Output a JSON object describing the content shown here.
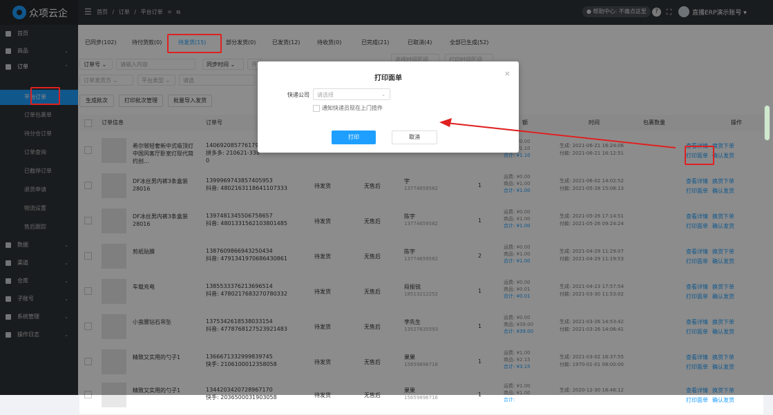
{
  "header": {
    "logo_text": "众项云企",
    "menu_icon": "hamburger-icon",
    "breadcrumb": [
      "首页",
      "/",
      "订单",
      "/",
      "平台订单",
      "≐",
      "⧉"
    ],
    "help_text": "● 帮助中心: 不痛点这里",
    "username": "直播ERP演示账号 ▾"
  },
  "sidebar": {
    "items": [
      {
        "label": "首页",
        "arrow": ""
      },
      {
        "label": "商品",
        "arrow": "⌄"
      },
      {
        "label": "订单",
        "arrow": "⌃"
      }
    ],
    "sub_items": [
      "平台订单",
      "订单包裹单",
      "待分仓订单",
      "订单查询",
      "已截停订单",
      "退货申请",
      "物流设置",
      "售后跟踪"
    ],
    "more_items": [
      {
        "label": "数据",
        "arrow": "⌄"
      },
      {
        "label": "渠道",
        "arrow": "⌄"
      },
      {
        "label": "仓库",
        "arrow": "⌄"
      },
      {
        "label": "子账号",
        "arrow": "⌄"
      },
      {
        "label": "系统管理",
        "arrow": "⌄"
      },
      {
        "label": "操作日志",
        "arrow": "⌄"
      }
    ]
  },
  "tabs": [
    "已同步(102)",
    "待付货款(0)",
    "待发货(15)",
    "部分发货(0)",
    "已发货(12)",
    "待收货(0)",
    "已完成(21)",
    "已取消(4)",
    "全部已生成(52)"
  ],
  "filters": {
    "row1": [
      "订单号 ⌄",
      "请输入内容",
      "同步时间 ⌄",
      "开",
      "至",
      "结束时间",
      "选择时间区间",
      "打印时间区间"
    ],
    "row2": [
      "订单发货方 ⌄",
      "平台类型 ⌄",
      "请选"
    ]
  },
  "actions": [
    "生成批次",
    "打印批次管理",
    "批量导入发货"
  ],
  "table_headers": [
    "订单信息",
    "订单号",
    "额",
    "时间",
    "包裹数量",
    "操作"
  ],
  "rows": [
    {
      "name": "希尔顿轻奢新中式吸顶灯中国风客厅卧室灯现代简约创...",
      "order_no": "14069208577617920",
      "platform_no": "拼多多: 210621-338",
      "extra": "0",
      "status": "",
      "after": "",
      "buyer": "",
      "phone": "13774659582",
      "qty": "",
      "fee": "运费: ¥0.00",
      "goods": "商品: ¥1.10",
      "total": "合计: ¥1.10",
      "created": "生成: 2021-06-21 16:24:06",
      "paid": "付款: 2021-06-21 16:12:51",
      "op1": "查看详情",
      "op2": "换货下单",
      "op3": "打印面单",
      "op4": "确认发货"
    },
    {
      "name": "DF冰丝男内裤3条盒装28016",
      "order_no": "1399969743857405953",
      "platform_no": "抖音: 4802163118641107333",
      "extra": "",
      "status": "待发货",
      "after": "无售后",
      "buyer": "宇",
      "phone": "13774659582",
      "qty": "1",
      "fee": "运费: ¥0.00",
      "goods": "商品: ¥1.00",
      "total": "合计: ¥1.00",
      "created": "生成: 2021-06-02 14:02:52",
      "paid": "付款: 2021-05-28 15:08:13",
      "op1": "查看详情",
      "op2": "换货下单",
      "op3": "打印面单",
      "op4": "确认发货"
    },
    {
      "name": "DF冰丝男内裤3条盒装28016",
      "order_no": "1397481345506758657",
      "platform_no": "抖音: 4801331562103801485",
      "extra": "",
      "status": "待发货",
      "after": "无售后",
      "buyer": "陈宇",
      "phone": "13774659582",
      "qty": "1",
      "fee": "运费: ¥0.00",
      "goods": "商品: ¥1.00",
      "total": "合计: ¥1.00",
      "created": "生成: 2021-05-26 17:14:51",
      "paid": "付款: 2021-05-26 09:24:24",
      "op1": "查看详情",
      "op2": "换货下单",
      "op3": "打印面单",
      "op4": "确认发货"
    },
    {
      "name": "剪纸贴膜",
      "order_no": "138760986694325043­4",
      "platform_no": "抖音: 4791341970686430861",
      "extra": "",
      "status": "待发货",
      "after": "无售后",
      "buyer": "陈宇",
      "phone": "13774659582",
      "qty": "2",
      "fee": "运费: ¥0.00",
      "goods": "商品: ¥1.00",
      "total": "合计: ¥1.00",
      "created": "生成: 2021-04-29 11:29:07",
      "paid": "付款: 2021-04-29 11:19:53",
      "op1": "查看详情",
      "op2": "换货下单",
      "op3": "打印面单",
      "op4": "确认发货"
    },
    {
      "name": "车载充电",
      "order_no": "1385533376213696514",
      "platform_no": "抖音: 4780217683270780332",
      "extra": "",
      "status": "待发货",
      "after": "无售后",
      "buyer": "段振锐",
      "phone": "18513212252",
      "qty": "1",
      "fee": "运费: ¥0.00",
      "goods": "商品: ¥0.01",
      "total": "合计: ¥0.01",
      "created": "生成: 2021-04-23 17:57:54",
      "paid": "付款: 2021-03-30 11:53:02",
      "op1": "查看详情",
      "op2": "换货下单",
      "op3": "打印面单",
      "op4": "确认发货"
    },
    {
      "name": "小蛮腰钻石吊坠",
      "order_no": "1375342618538033154",
      "platform_no": "抖音: 4778768127523921483",
      "extra": "",
      "status": "待发货",
      "after": "无售后",
      "buyer": "李先生",
      "phone": "13527635593",
      "qty": "1",
      "fee": "运费: ¥0.00",
      "goods": "商品: ¥39.00",
      "total": "合计: ¥39.00",
      "created": "生成: 2021-03-26 14:53:42",
      "paid": "付款: 2021-03-26 14:06:41",
      "op1": "查看详情",
      "op2": "换货下单",
      "op3": "打印面单",
      "op4": "确认发货"
    },
    {
      "name": "精致又实用的勺子1",
      "order_no": "1366671332999839745",
      "platform_no": "快手: 2106100012358058",
      "extra": "",
      "status": "待发货",
      "after": "无售后",
      "buyer": "果果",
      "phone": "15659896716",
      "qty": "1",
      "fee": "运费: ¥1.00",
      "goods": "商品: ¥2.15",
      "total": "合计: ¥3.15",
      "created": "生成: 2021-03-02 16:37:55",
      "paid": "付款: 1970-01-01 08:00:00",
      "op1": "查看详情",
      "op2": "换货下单",
      "op3": "打印面单",
      "op4": "确认发货"
    },
    {
      "name": "精致又实用的勺子1",
      "order_no": "1344203420728967170",
      "platform_no": "快手: 2036500031903058",
      "extra": "",
      "status": "待发货",
      "after": "无售后",
      "buyer": "果果",
      "phone": "15659896716",
      "qty": "1",
      "fee": "运费: ¥1.00",
      "goods": "商品: ¥1.00",
      "total": "合计:",
      "created": "生成: 2020-12-30 16:46:12",
      "paid": "",
      "op1": "查看详情",
      "op2": "换货下单",
      "op3": "打印面单",
      "op4": "确认发货"
    }
  ],
  "modal": {
    "title": "打印面单",
    "close": "×",
    "field_label": "快递公司",
    "select_placeholder": "请选择",
    "checkbox_label": "通知快递员现在上门揽件",
    "print_label": "打印",
    "cancel_label": "取消"
  },
  "colors": {
    "accent": "#1e9fff",
    "sidebar": "#2f3338",
    "highlight": "#e02020"
  }
}
